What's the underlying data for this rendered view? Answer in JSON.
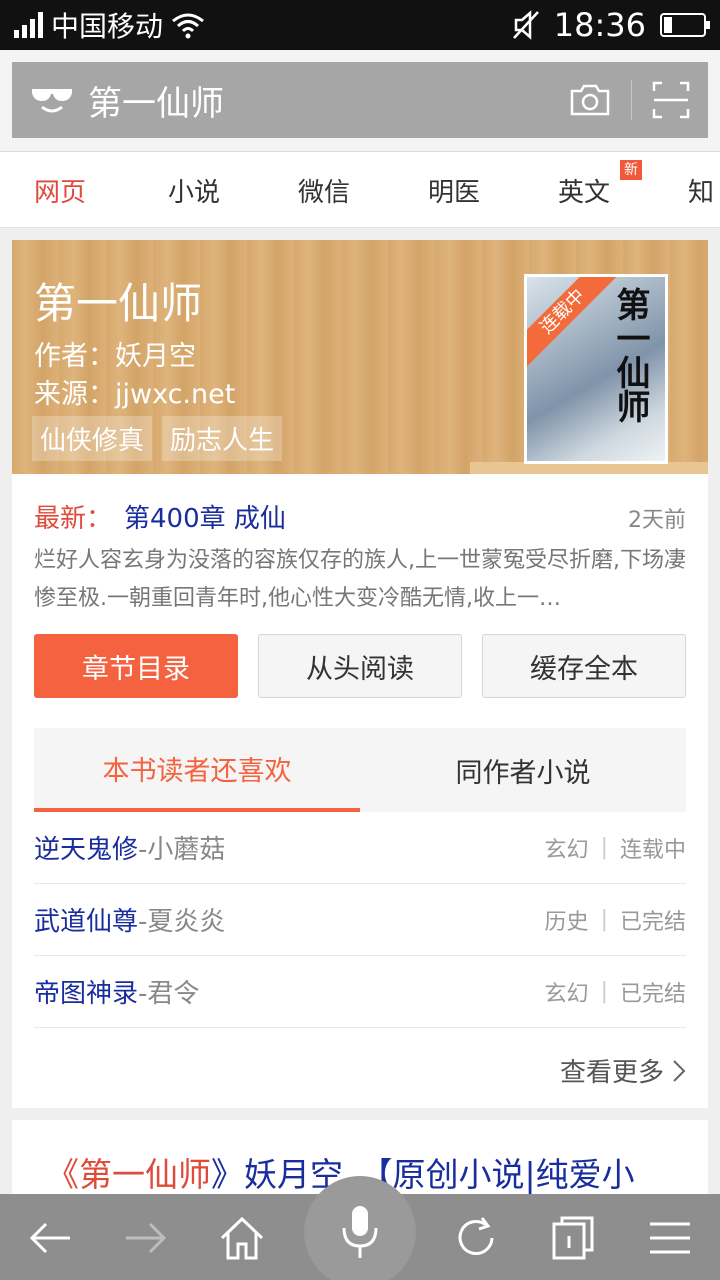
{
  "status_bar": {
    "carrier": "中国移动",
    "time": "18:36"
  },
  "search": {
    "query": "第一仙师"
  },
  "tabs": [
    {
      "label": "网页",
      "active": true
    },
    {
      "label": "小说",
      "active": false
    },
    {
      "label": "微信",
      "active": false
    },
    {
      "label": "明医",
      "active": false
    },
    {
      "label": "英文",
      "active": false,
      "badge": "新"
    },
    {
      "label": "知",
      "active": false
    }
  ],
  "book": {
    "title": "第一仙师",
    "author_line": "作者：妖月空",
    "source_line": "来源：jjwxc.net",
    "tags": [
      "仙侠修真",
      "励志人生"
    ],
    "cover": {
      "ribbon": "连载中",
      "title": "第一仙师"
    },
    "latest_label": "最新：",
    "latest_chapter": "第400章 成仙",
    "latest_time": "2天前",
    "description": "烂好人容玄身为没落的容族仅存的族人,上一世蒙冤受尽折磨,下场凄惨至极.一朝重回青年时,他心性大变冷酷无情,收上一…",
    "buttons": {
      "catalog": "章节目录",
      "read_from_start": "从头阅读",
      "cache_all": "缓存全本"
    }
  },
  "recommend": {
    "tabs": [
      "本书读者还喜欢",
      "同作者小说"
    ],
    "items": [
      {
        "title": "逆天鬼修",
        "author": "-小蘑菇",
        "genre": "玄幻",
        "status": "连载中"
      },
      {
        "title": "武道仙尊",
        "author": "-夏炎炎",
        "genre": "历史",
        "status": "已完结"
      },
      {
        "title": "帝图神录",
        "author": "-君令",
        "genre": "玄幻",
        "status": "已完结"
      }
    ],
    "more_label": "查看更多"
  },
  "result2": {
    "prefix": "《",
    "title": "第一仙师",
    "suffix": "》妖月空_【原创小说|纯爱小"
  },
  "colors": {
    "accent": "#f4623f",
    "link": "#1a2d9e",
    "banner": "#d7a96d"
  }
}
